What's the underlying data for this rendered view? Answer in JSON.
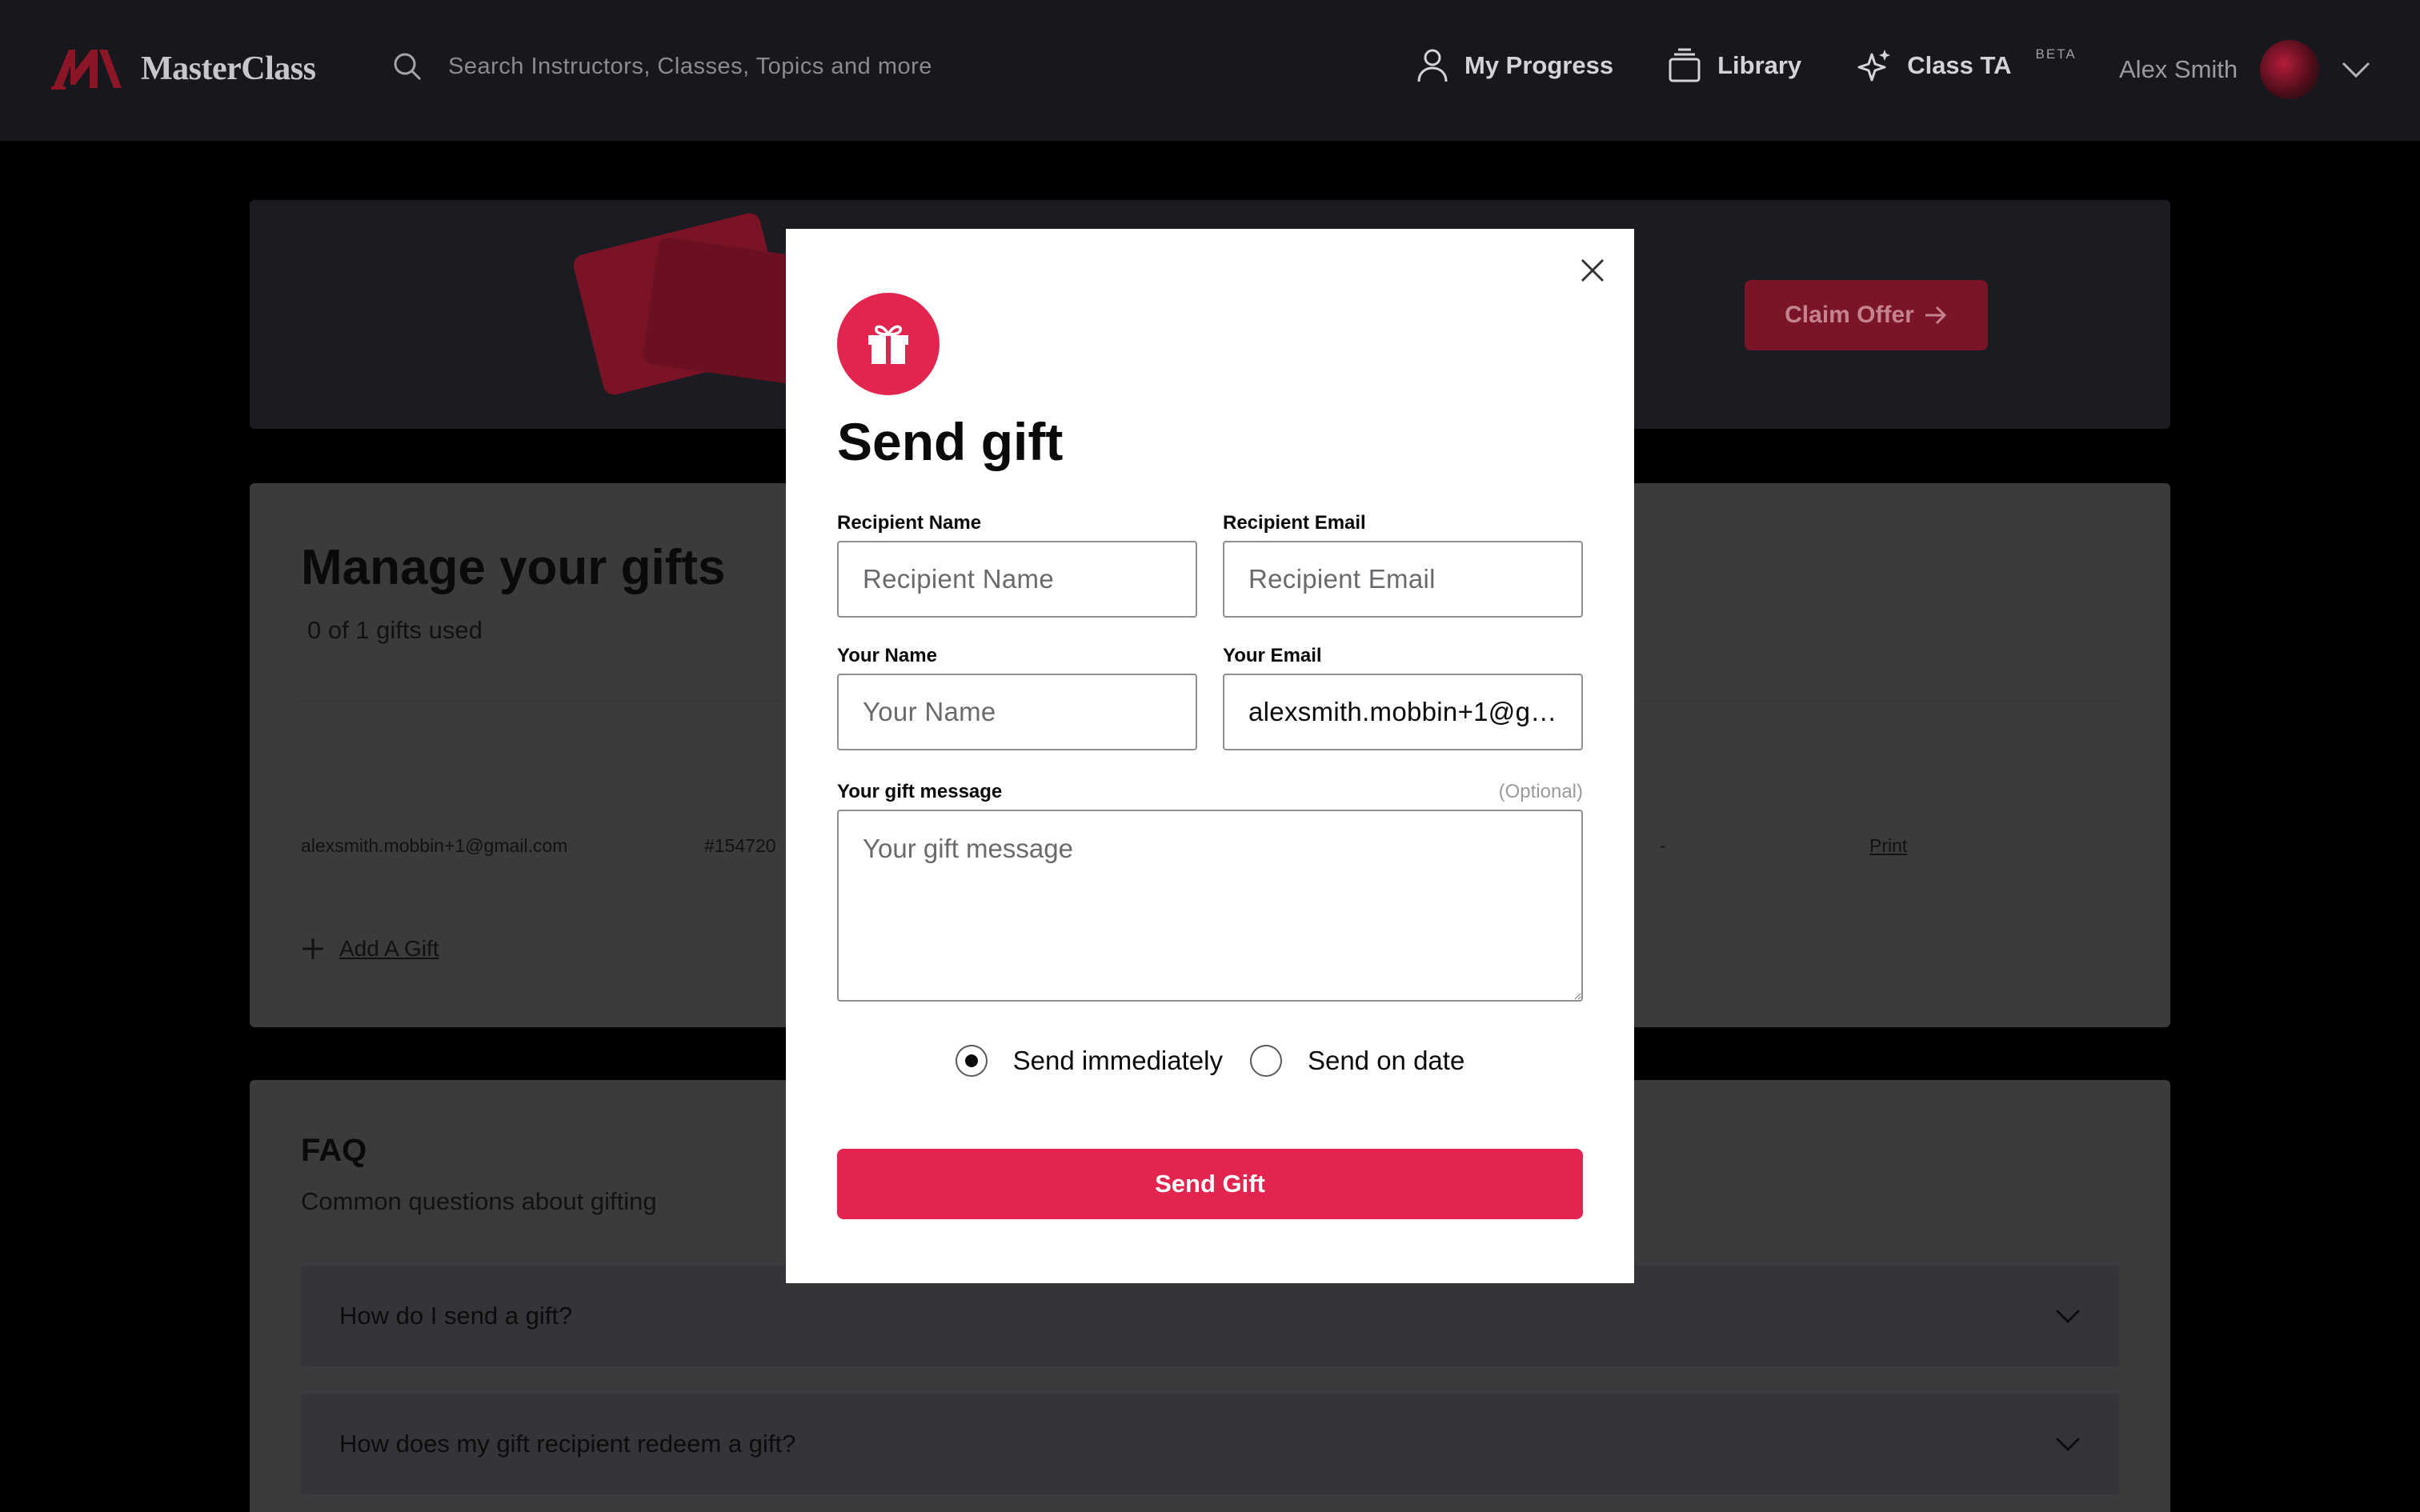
{
  "nav": {
    "logo_text": "MasterClass",
    "search_placeholder": "Search Instructors, Classes, Topics and more",
    "my_progress": "My Progress",
    "library": "Library",
    "class_ta": "Class TA",
    "class_ta_badge": "BETA",
    "user_name": "Alex Smith"
  },
  "promo": {
    "claim_label": "Claim Offer"
  },
  "manage": {
    "title": "Manage your gifts",
    "subtitle": "0 of 1 gifts used",
    "row": {
      "email": "alexsmith.mobbin+1@gmail.com",
      "id": "#154720",
      "sent": "-",
      "print": "Print"
    },
    "add_gift": "Add A Gift"
  },
  "faq": {
    "title": "FAQ",
    "subtitle": "Common questions about gifting",
    "items": [
      {
        "question": "How do I send a gift?"
      },
      {
        "question": "How does my gift recipient redeem a gift?"
      }
    ]
  },
  "modal": {
    "title": "Send gift",
    "recipient_name_label": "Recipient Name",
    "recipient_name_placeholder": "Recipient Name",
    "recipient_email_label": "Recipient Email",
    "recipient_email_placeholder": "Recipient Email",
    "your_name_label": "Your Name",
    "your_name_placeholder": "Your Name",
    "your_email_label": "Your Email",
    "your_email_value": "alexsmith.mobbin+1@g…",
    "message_label": "Your gift message",
    "message_optional": "(Optional)",
    "message_placeholder": "Your gift message",
    "send_immediately": "Send immediately",
    "send_on_date": "Send on date",
    "send_button": "Send Gift"
  },
  "colors": {
    "accent": "#e3244f",
    "nav_bg": "#16181d"
  }
}
